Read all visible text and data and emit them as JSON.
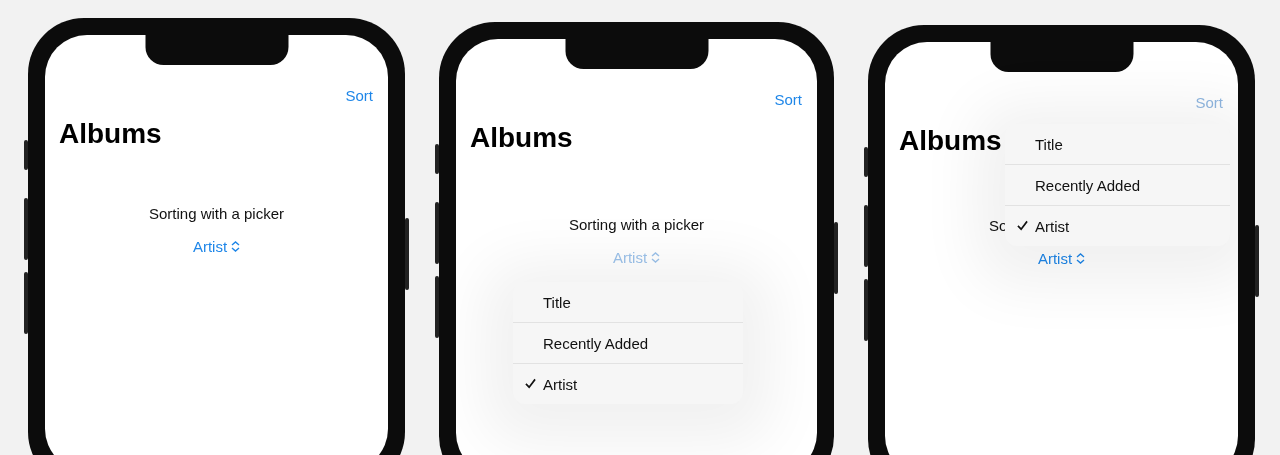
{
  "phones": [
    {
      "sort_label": "Sort",
      "sort_dimmed": false,
      "title": "Albums",
      "caption": "Sorting with a picker",
      "picker_label": "Artist",
      "picker_dimmed": false
    },
    {
      "sort_label": "Sort",
      "sort_dimmed": false,
      "title": "Albums",
      "caption": "Sorting with a picker",
      "picker_label": "Artist",
      "picker_dimmed": true,
      "menu": {
        "kind": "popdown",
        "items": [
          {
            "label": "Title",
            "selected": false
          },
          {
            "label": "Recently Added",
            "selected": false
          },
          {
            "label": "Artist",
            "selected": true
          }
        ]
      }
    },
    {
      "sort_label": "Sort",
      "sort_dimmed": true,
      "title": "Albums",
      "caption": "So",
      "picker_label": "Artist",
      "picker_dimmed": false,
      "menu": {
        "kind": "popup",
        "items": [
          {
            "label": "Title",
            "selected": false
          },
          {
            "label": "Recently Added",
            "selected": false
          },
          {
            "label": "Artist",
            "selected": true
          }
        ]
      }
    }
  ]
}
